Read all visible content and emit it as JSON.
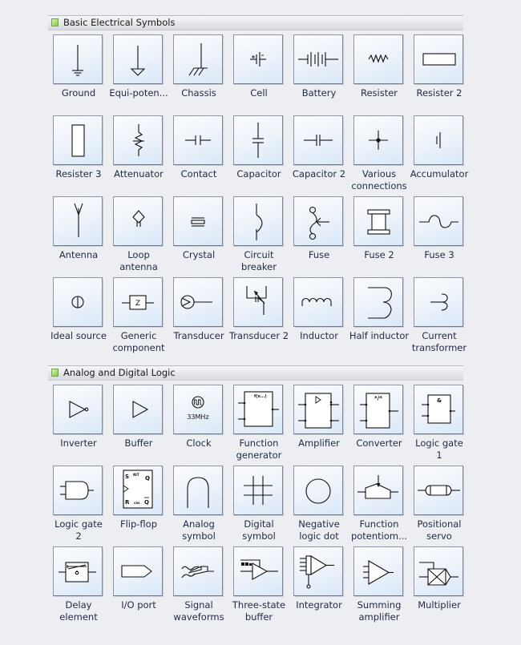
{
  "sections": [
    {
      "title": "Basic Electrical Symbols",
      "icon": "green-square-icon",
      "items": [
        {
          "label": "Ground",
          "icon": "ground-icon"
        },
        {
          "label": "Equi-poten...",
          "icon": "equipotential-icon"
        },
        {
          "label": "Chassis",
          "icon": "chassis-icon"
        },
        {
          "label": "Cell",
          "icon": "cell-icon"
        },
        {
          "label": "Battery",
          "icon": "battery-icon"
        },
        {
          "label": "Resister",
          "icon": "resister-icon"
        },
        {
          "label": "Resister 2",
          "icon": "resister-2-icon"
        },
        {
          "label": "Resister 3",
          "icon": "resister-3-icon"
        },
        {
          "label": "Attenuator",
          "icon": "attenuator-icon"
        },
        {
          "label": "Contact",
          "icon": "contact-icon"
        },
        {
          "label": "Capacitor",
          "icon": "capacitor-icon"
        },
        {
          "label": "Capacitor 2",
          "icon": "capacitor-2-icon"
        },
        {
          "label": "Various\nconnections",
          "icon": "various-connections-icon"
        },
        {
          "label": "Accumulator",
          "icon": "accumulator-icon"
        },
        {
          "label": "Antenna",
          "icon": "antenna-icon"
        },
        {
          "label": "Loop\nantenna",
          "icon": "loop-antenna-icon"
        },
        {
          "label": "Crystal",
          "icon": "crystal-icon"
        },
        {
          "label": "Circuit\nbreaker",
          "icon": "circuit-breaker-icon"
        },
        {
          "label": "Fuse",
          "icon": "fuse-icon"
        },
        {
          "label": "Fuse 2",
          "icon": "fuse-2-icon"
        },
        {
          "label": "Fuse 3",
          "icon": "fuse-3-icon"
        },
        {
          "label": "Ideal source",
          "icon": "ideal-source-icon"
        },
        {
          "label": "Generic\ncomponent",
          "icon": "generic-component-icon",
          "glyph": "Z"
        },
        {
          "label": "Transducer",
          "icon": "transducer-icon"
        },
        {
          "label": "Transducer 2",
          "icon": "transducer-2-icon"
        },
        {
          "label": "Inductor",
          "icon": "inductor-icon"
        },
        {
          "label": "Half inductor",
          "icon": "half-inductor-icon"
        },
        {
          "label": "Current\ntransformer",
          "icon": "current-transformer-icon"
        }
      ]
    },
    {
      "title": "Analog and Digital Logic",
      "icon": "green-square-icon",
      "items": [
        {
          "label": "Inverter",
          "icon": "inverter-icon"
        },
        {
          "label": "Buffer",
          "icon": "buffer-icon"
        },
        {
          "label": "Clock",
          "icon": "clock-icon",
          "glyph": "33MHz"
        },
        {
          "label": "Function\ngenerator",
          "icon": "function-generator-icon"
        },
        {
          "label": "Amplifier",
          "icon": "amplifier-icon"
        },
        {
          "label": "Converter",
          "icon": "converter-icon",
          "glyph": "*/*"
        },
        {
          "label": "Logic gate\n1",
          "icon": "logic-gate-1-icon",
          "glyph": "&"
        },
        {
          "label": "Logic gate\n2",
          "icon": "logic-gate-2-icon"
        },
        {
          "label": "Flip-flop",
          "icon": "flip-flop-icon"
        },
        {
          "label": "Analog\nsymbol",
          "icon": "analog-symbol-icon"
        },
        {
          "label": "Digital\nsymbol",
          "icon": "digital-symbol-icon"
        },
        {
          "label": "Negative\nlogic dot",
          "icon": "negative-logic-dot-icon"
        },
        {
          "label": "Function\npotentiom...",
          "icon": "function-potentiometer-icon"
        },
        {
          "label": "Positional\nservo",
          "icon": "positional-servo-icon"
        },
        {
          "label": "Delay\nelement",
          "icon": "delay-element-icon"
        },
        {
          "label": "I/O port",
          "icon": "io-port-icon"
        },
        {
          "label": "Signal\nwaveforms",
          "icon": "signal-waveforms-icon"
        },
        {
          "label": "Three-state\nbuffer",
          "icon": "three-state-buffer-icon"
        },
        {
          "label": "Integrator",
          "icon": "integrator-icon"
        },
        {
          "label": "Summing\namplifier",
          "icon": "summing-amplifier-icon"
        },
        {
          "label": "Multiplier",
          "icon": "multiplier-icon"
        }
      ]
    }
  ]
}
